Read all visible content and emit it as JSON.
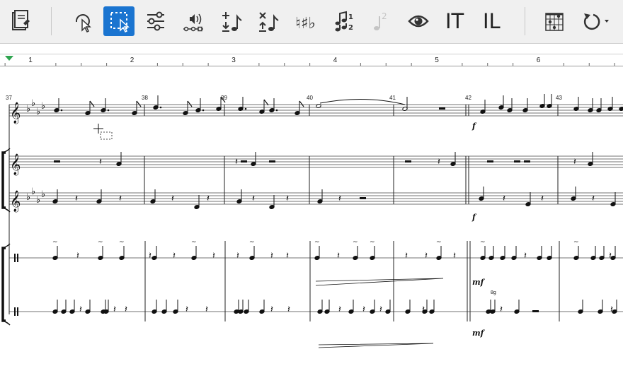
{
  "toolbar": {
    "tools": [
      {
        "id": "score-edit",
        "icon": "score-page-icon",
        "active": false
      },
      {
        "id": "select",
        "icon": "pointer-icon",
        "active": false
      },
      {
        "id": "marquee-select",
        "icon": "dashed-selection-icon",
        "active": true
      },
      {
        "id": "properties",
        "icon": "sliders-icon",
        "active": false
      },
      {
        "id": "playback",
        "icon": "sound-wave-icon",
        "active": false
      },
      {
        "id": "add-note",
        "icon": "add-note-icon",
        "active": false
      },
      {
        "id": "delete-note",
        "icon": "delete-note-icon",
        "active": false
      },
      {
        "id": "accidentals",
        "icon": "sharp-flat-icon",
        "active": false
      },
      {
        "id": "voices",
        "icon": "voices-icon",
        "active": false
      },
      {
        "id": "voice-2",
        "icon": "voice-2-icon",
        "active": false,
        "disabled": true
      },
      {
        "id": "view",
        "icon": "eye-icon",
        "active": false
      },
      {
        "id": "text",
        "icon": "text-cursor-icon",
        "active": false
      },
      {
        "id": "lyrics",
        "icon": "lyrics-icon",
        "active": false
      },
      {
        "id": "chord-diagram",
        "icon": "guitar-chord-icon",
        "active": false
      },
      {
        "id": "undo",
        "icon": "undo-icon",
        "active": false
      }
    ],
    "voice_badge": "2",
    "voice_num_1": "1",
    "voice_num_2": "2",
    "text_tool_label": "IT",
    "lyrics_tool_label": "IL",
    "accent_color": "#1a74d0"
  },
  "ruler": {
    "numbers": [
      "1",
      "2",
      "3",
      "4",
      "5",
      "6"
    ],
    "marker_color": "#2ea44f"
  },
  "score": {
    "measure_numbers": [
      "37",
      "38",
      "39",
      "40",
      "41",
      "42",
      "43"
    ],
    "dynamics": [
      {
        "text": "f",
        "staff": 0,
        "measure": "42"
      },
      {
        "text": "f",
        "staff": 2,
        "measure": "42"
      },
      {
        "text": "mf",
        "staff": 3,
        "measure": "42"
      },
      {
        "text": "mf",
        "staff": 4,
        "measure": "42"
      }
    ],
    "grace_label": "8g"
  }
}
